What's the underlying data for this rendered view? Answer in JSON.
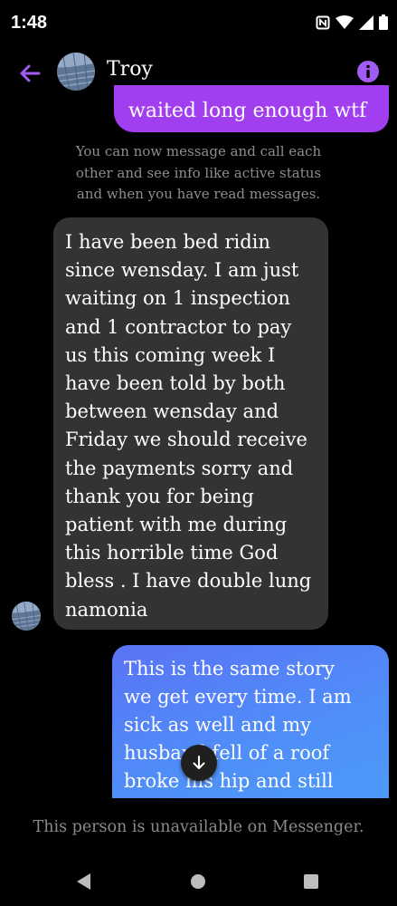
{
  "status_bar": {
    "time": "1:48",
    "icons": [
      "nfc-icon",
      "wifi-icon",
      "signal-icon",
      "battery-icon"
    ]
  },
  "header": {
    "contact_name": "Troy",
    "back_icon": "arrow-left-icon",
    "info_icon": "info-icon",
    "accent_color": "#a25cf5"
  },
  "messages": {
    "top_sent": {
      "text": "waited long enough wtf",
      "color": "#a03ef0"
    },
    "notice_lines": [
      "You can now message and call each",
      "other and see info like active status",
      "and when you have read messages."
    ],
    "received": {
      "lines": [
        "I have been bed ridin",
        "since wensday.  I am just",
        "waiting on 1 inspection",
        "and 1 contractor to pay",
        "us this coming week I",
        "have been told by both",
        "between wensday and",
        "Friday we should receive",
        "the payments sorry and",
        "thank you for being",
        "patient with me during",
        "this horrible time God",
        "bless . I have double lung",
        "namonia"
      ],
      "color": "#333336"
    },
    "sent": {
      "lines": [
        "This is the same story",
        "we get every time. I am",
        "sick as well and my",
        "husband fell of a roof",
        "broke his hip and still"
      ],
      "color": "#5085f7"
    }
  },
  "scroll_down_icon": "arrow-down-icon",
  "footer": {
    "unavailable_text": "This person is unavailable on Messenger."
  },
  "nav_bar": {
    "icons": [
      "back-triangle-icon",
      "home-circle-icon",
      "recents-square-icon"
    ]
  }
}
